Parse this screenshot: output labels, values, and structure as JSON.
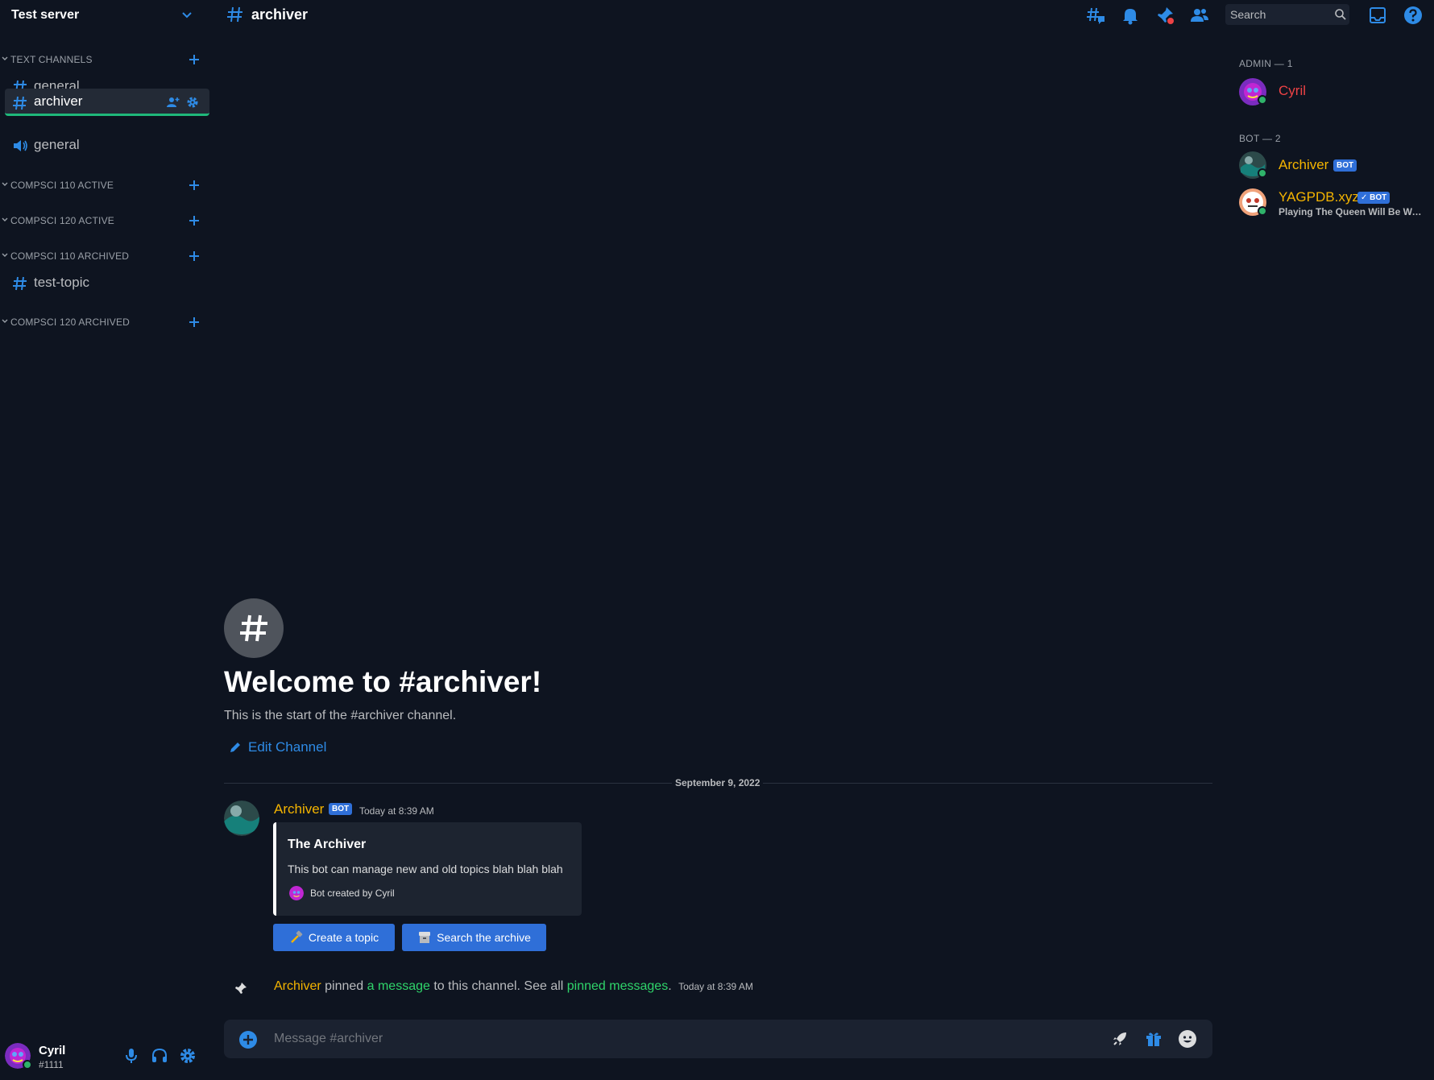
{
  "server": {
    "name": "Test server"
  },
  "categories": [
    {
      "label": "TEXT CHANNELS"
    },
    {
      "label": "COMPSCI 110 ACTIVE"
    },
    {
      "label": "COMPSCI 120 ACTIVE"
    },
    {
      "label": "COMPSCI 110 ARCHIVED"
    },
    {
      "label": "COMPSCI 120 ARCHIVED"
    }
  ],
  "channels": [
    {
      "label": "general",
      "type": "text"
    },
    {
      "label": "archiver",
      "type": "text",
      "active": true
    },
    {
      "label": "general",
      "type": "voice"
    },
    {
      "label": "test-topic",
      "type": "text"
    }
  ],
  "user": {
    "name": "Cyril",
    "tag": "#1111",
    "status": "online"
  },
  "header": {
    "channel_title": "archiver"
  },
  "search": {
    "placeholder": "Search"
  },
  "members": {
    "roles": [
      {
        "heading": "ADMIN — 1"
      },
      {
        "heading": "BOT — 2"
      }
    ],
    "list": [
      {
        "name": "Cyril",
        "color": "#ed4245"
      },
      {
        "name": "Archiver",
        "badge": "BOT",
        "color": "#f4b400"
      },
      {
        "name": "YAGPDB.xyz",
        "badge": "✓ BOT",
        "activity": "Playing The Queen Will Be Wa...",
        "color": "#f4b400"
      }
    ]
  },
  "welcome": {
    "title": "Welcome to #archiver!",
    "subtitle": "This is the start of the #archiver channel.",
    "edit_label": "Edit Channel"
  },
  "date_divider": "September 9, 2022",
  "message": {
    "author": "Archiver",
    "badge": "BOT",
    "time": "Today at 8:39 AM",
    "embed": {
      "title": "The Archiver",
      "description": "This bot can manage new and old topics blah blah blah",
      "footer": "Bot created by Cyril"
    },
    "buttons": [
      {
        "label": "Create a topic",
        "icon": "hammer-icon"
      },
      {
        "label": "Search the archive",
        "icon": "archive-box-icon"
      }
    ]
  },
  "system_message": {
    "author": "Archiver",
    "text1": " pinned ",
    "link1": "a message",
    "text2": " to this channel. See all ",
    "link2": "pinned messages",
    "text3": ".",
    "time": "Today at 8:39 AM"
  },
  "composer": {
    "placeholder": "Message #archiver"
  },
  "colors": {
    "background": "#0e1420",
    "accent": "#2e8be6",
    "bot_name": "#f4b400",
    "admin_name": "#ed4245",
    "link_green": "#2fd46a",
    "online": "#2fb36a"
  }
}
